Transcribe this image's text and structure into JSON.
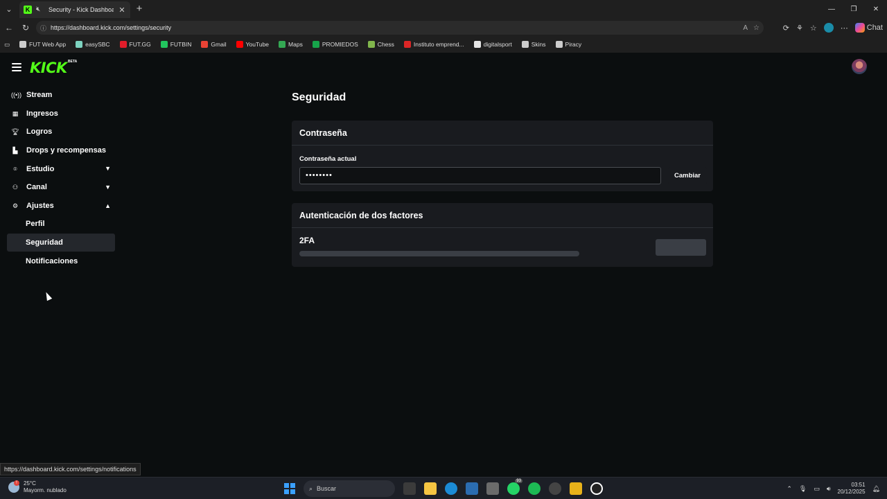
{
  "browser": {
    "tab_title": "Security - Kick Dashboard",
    "url": "https://dashboard.kick.com/settings/security",
    "chat_label": "Chat",
    "bookmarks": [
      {
        "label": "FUT Web App",
        "color": "#cccccc"
      },
      {
        "label": "easySBC",
        "color": "#7dd3c0"
      },
      {
        "label": "FUT.GG",
        "color": "#e11d2a"
      },
      {
        "label": "FUTBIN",
        "color": "#22c55e"
      },
      {
        "label": "Gmail",
        "color": "#ea4335"
      },
      {
        "label": "YouTube",
        "color": "#ff0000"
      },
      {
        "label": "Maps",
        "color": "#34a853"
      },
      {
        "label": "PROMIEDOS",
        "color": "#16a34a"
      },
      {
        "label": "Chess",
        "color": "#81b64c"
      },
      {
        "label": "Instituto emprend...",
        "color": "#dc2626"
      },
      {
        "label": "digitalsport",
        "color": "#e5e5e5"
      },
      {
        "label": "Skins",
        "color": "#cccccc"
      },
      {
        "label": "Piracy",
        "color": "#cccccc"
      }
    ],
    "status_url": "https://dashboard.kick.com/settings/notifications"
  },
  "app": {
    "logo": "KICK",
    "logo_badge": "BETA",
    "brand_color": "#53fc18"
  },
  "sidebar": {
    "items": [
      {
        "label": "Stream",
        "icon": "broadcast-icon"
      },
      {
        "label": "Ingresos",
        "icon": "revenue-icon"
      },
      {
        "label": "Logros",
        "icon": "trophy-icon"
      },
      {
        "label": "Drops y recompensas",
        "icon": "drops-icon"
      },
      {
        "label": "Estudio",
        "icon": "studio-icon"
      },
      {
        "label": "Canal",
        "icon": "channel-icon"
      },
      {
        "label": "Ajustes",
        "icon": "gear-icon"
      }
    ],
    "sub_items": [
      {
        "label": "Perfil"
      },
      {
        "label": "Seguridad",
        "active": true
      },
      {
        "label": "Notificaciones"
      }
    ]
  },
  "main": {
    "title": "Seguridad",
    "password_card": {
      "heading": "Contraseña",
      "field_label": "Contraseña actual",
      "field_value": "••••••••",
      "button_label": "Cambiar"
    },
    "twofa_card": {
      "heading": "Autenticación de dos factores",
      "label": "2FA"
    }
  },
  "taskbar": {
    "temperature": "25°C",
    "weather": "Mayorm. nublado",
    "search_placeholder": "Buscar",
    "whatsapp_badge": "93",
    "time": "03:51",
    "date": "20/12/2025"
  }
}
